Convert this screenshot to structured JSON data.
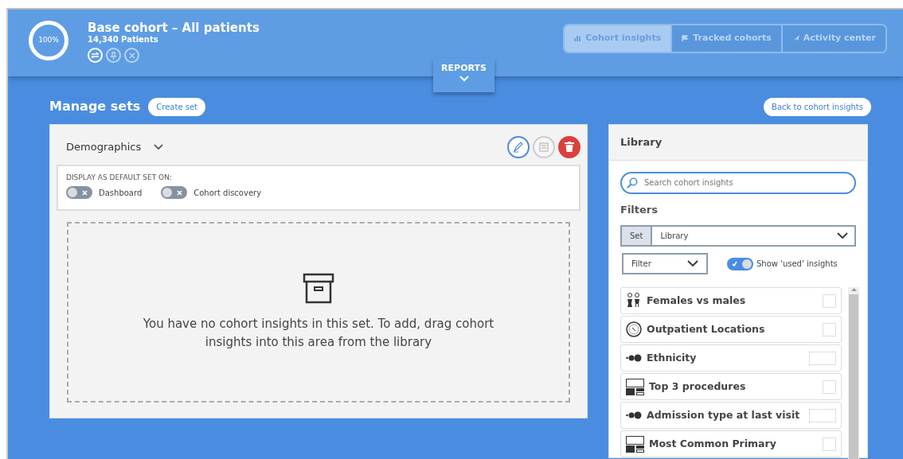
{
  "header": {
    "progress_label": "100%",
    "title": "Base cohort – All patients",
    "subtitle": "14,340 Patients",
    "tabs": [
      {
        "label": "Cohort insights",
        "kind": "bars",
        "selected": true
      },
      {
        "label": "Tracked cohorts",
        "kind": "flag",
        "selected": false
      },
      {
        "label": "Activity center",
        "kind": "rocket",
        "selected": false
      }
    ],
    "reports_label": "REPORTS"
  },
  "manage": {
    "title": "Manage sets",
    "create_label": "Create set",
    "back_label": "Back to cohort insights"
  },
  "set_panel": {
    "set_name": "Demographics",
    "default_heading": "DISPLAY AS DEFAULT SET ON:",
    "toggles": [
      {
        "label": "Dashboard",
        "on": false
      },
      {
        "label": "Cohort discovery",
        "on": false
      }
    ],
    "empty_message": "You have no cohort insights in this set. To add, drag cohort insights into this area from the library"
  },
  "library": {
    "title": "Library",
    "search_placeholder": "Search cohort insights",
    "filters_heading": "Filters",
    "set_label": "Set",
    "set_value": "Library",
    "filter_value": "Filter",
    "show_used": {
      "label": "Show 'used' insights",
      "on": true
    },
    "items": [
      {
        "label": "Females vs males",
        "kind": "people"
      },
      {
        "label": "Outpatient Locations",
        "kind": "gauge"
      },
      {
        "label": "Ethnicity",
        "kind": "dots"
      },
      {
        "label": "Top 3 procedures",
        "kind": "blocks"
      },
      {
        "label": "Admission type at last visit",
        "kind": "dots"
      },
      {
        "label": "Most Common Primary",
        "kind": "blocks"
      }
    ]
  }
}
